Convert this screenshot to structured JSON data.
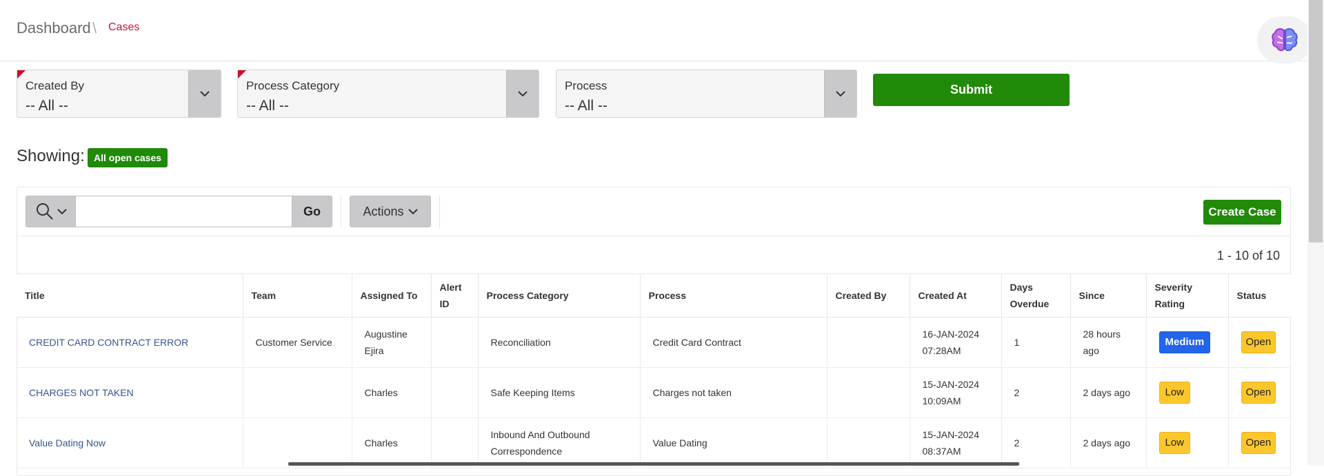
{
  "breadcrumb": {
    "root": "Dashboard",
    "separator": "\\",
    "current": "Cases"
  },
  "filters": [
    {
      "label": "Created By",
      "value": "-- All --",
      "required": true
    },
    {
      "label": "Process Category",
      "value": "-- All --",
      "required": true
    },
    {
      "label": "Process",
      "value": "-- All --",
      "required": false
    }
  ],
  "submit_label": "Submit",
  "showing": {
    "label": "Showing:",
    "badge": "All open cases"
  },
  "toolbar": {
    "go_label": "Go",
    "actions_label": "Actions",
    "create_label": "Create Case",
    "search_value": ""
  },
  "pagination": "1 - 10 of 10",
  "columns": [
    "Title",
    "Team",
    "Assigned To",
    "Alert ID",
    "Process Category",
    "Process",
    "Created By",
    "Created At",
    "Days Overdue",
    "Since",
    "Severity Rating",
    "Status"
  ],
  "rows": [
    {
      "title": "CREDIT CARD CONTRACT ERROR",
      "team": "Customer Service",
      "assigned_to": "Augustine Ejira",
      "alert_id": "",
      "process_category": "Reconciliation",
      "process": "Credit Card Contract",
      "created_by": "",
      "created_at": "16-JAN-2024 07:28AM",
      "days_overdue": "1",
      "since": "28 hours ago",
      "severity": "Medium",
      "status": "Open"
    },
    {
      "title": "CHARGES NOT TAKEN",
      "team": "",
      "assigned_to": "Charles",
      "alert_id": "",
      "process_category": "Safe Keeping Items",
      "process": "Charges not taken",
      "created_by": "",
      "created_at": "15-JAN-2024 10:09AM",
      "days_overdue": "2",
      "since": "2 days ago",
      "severity": "Low",
      "status": "Open"
    },
    {
      "title": "Value Dating Now",
      "team": "",
      "assigned_to": "Charles",
      "alert_id": "",
      "process_category": "Inbound And Outbound Correspondence",
      "process": "Value Dating",
      "created_by": "",
      "created_at": "15-JAN-2024 08:37AM",
      "days_overdue": "2",
      "since": "2 days ago",
      "severity": "Low",
      "status": "Open"
    }
  ],
  "colors": {
    "primary_green": "#218a09",
    "required_red": "#c8102e",
    "severity_medium": "#2265ea",
    "warning_yellow": "#fcc72d",
    "link_blue": "#34558b"
  },
  "icons": {
    "brain": "brain-icon",
    "chevron": "chevron-down-icon",
    "search": "search-icon"
  }
}
